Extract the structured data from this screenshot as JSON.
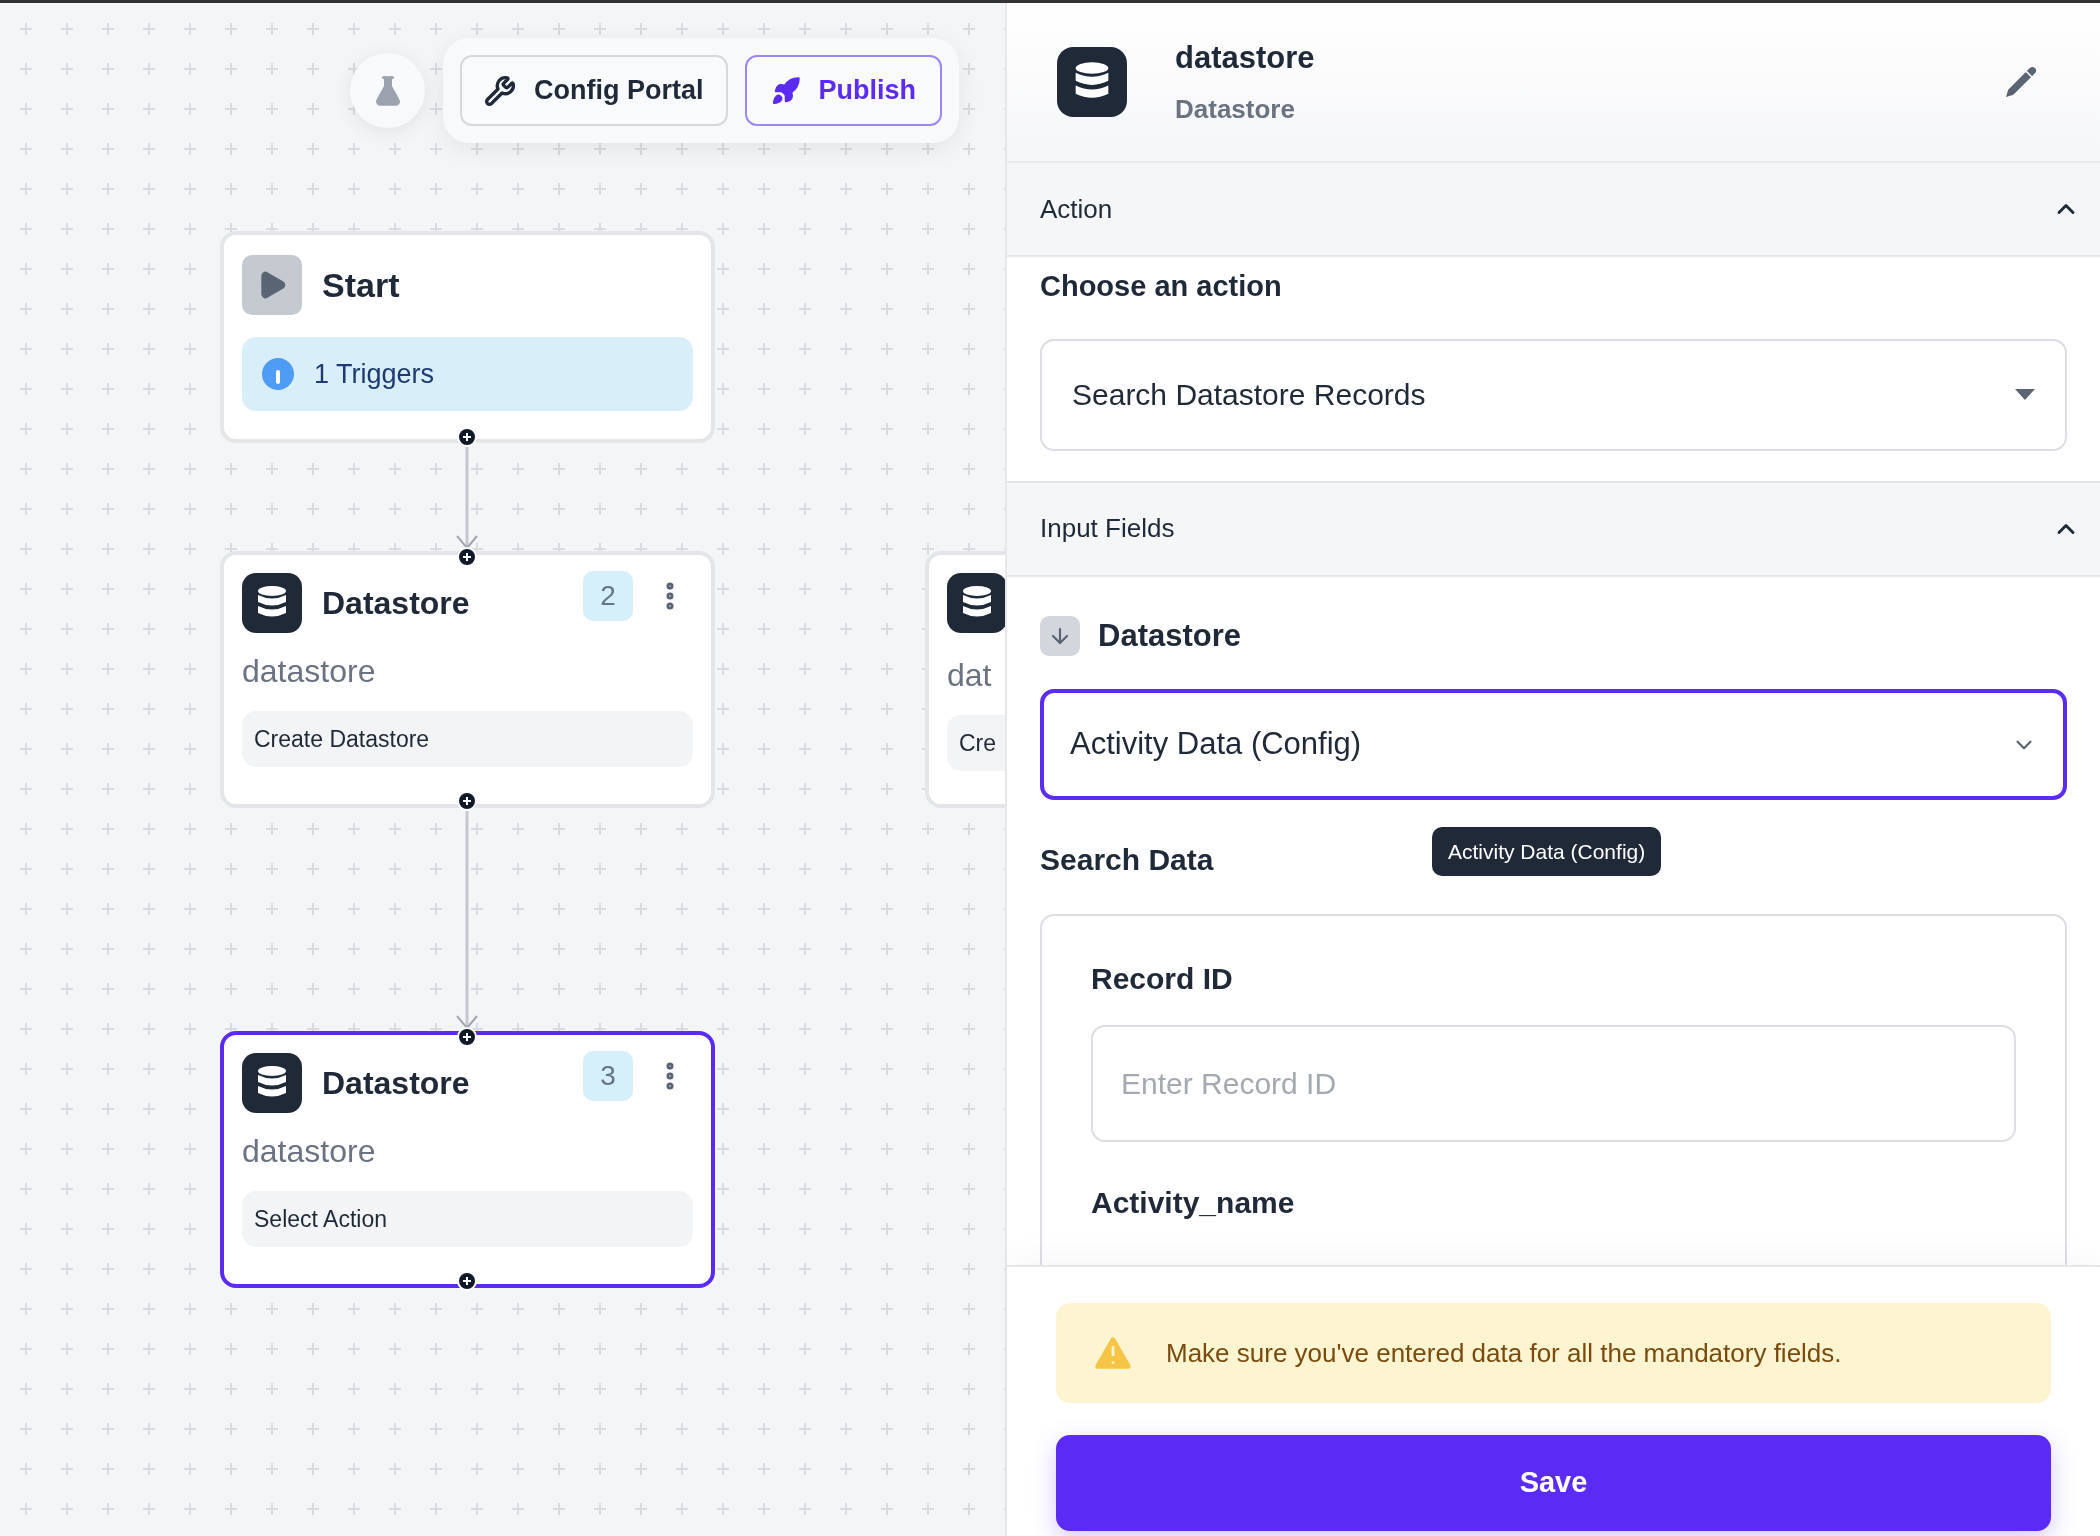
{
  "toolbar": {
    "buttons": [
      {
        "kind": "config",
        "label": "Config Portal"
      },
      {
        "kind": "publish",
        "label": "Publish"
      }
    ]
  },
  "nodes": [
    {
      "kind": "start",
      "title": "Start",
      "triggers": "1 Triggers",
      "selected": false
    },
    {
      "kind": "step",
      "title": "Datastore",
      "number": "2",
      "subtitle": "datastore",
      "action": "Create Datastore",
      "selected": false
    },
    {
      "kind": "step",
      "title": "Datastore",
      "number": "3",
      "subtitle": "datastore",
      "action": "Select Action",
      "selected": true
    },
    {
      "kind": "partial",
      "subtitle": "dat",
      "action": "Cre",
      "selected": false
    }
  ],
  "panel": {
    "title": "datastore",
    "subtitle": "Datastore",
    "action_section": {
      "title": "Action",
      "expanded": true,
      "label": "Choose an action",
      "value": "Search Datastore Records"
    },
    "input_section": {
      "title": "Input Fields",
      "expanded": true,
      "datastore_label": "Datastore",
      "datastore_value": "Activity Data (Config)",
      "datastore_focused": true,
      "search_label": "Search Data",
      "tooltip": "Activity Data (Config)",
      "fields": [
        {
          "label": "Record ID",
          "placeholder": "Enter Record ID"
        },
        {
          "label": "Activity_name"
        }
      ]
    },
    "alert": "Make sure you've entered data for all the mandatory fields.",
    "save_label": "Save"
  }
}
